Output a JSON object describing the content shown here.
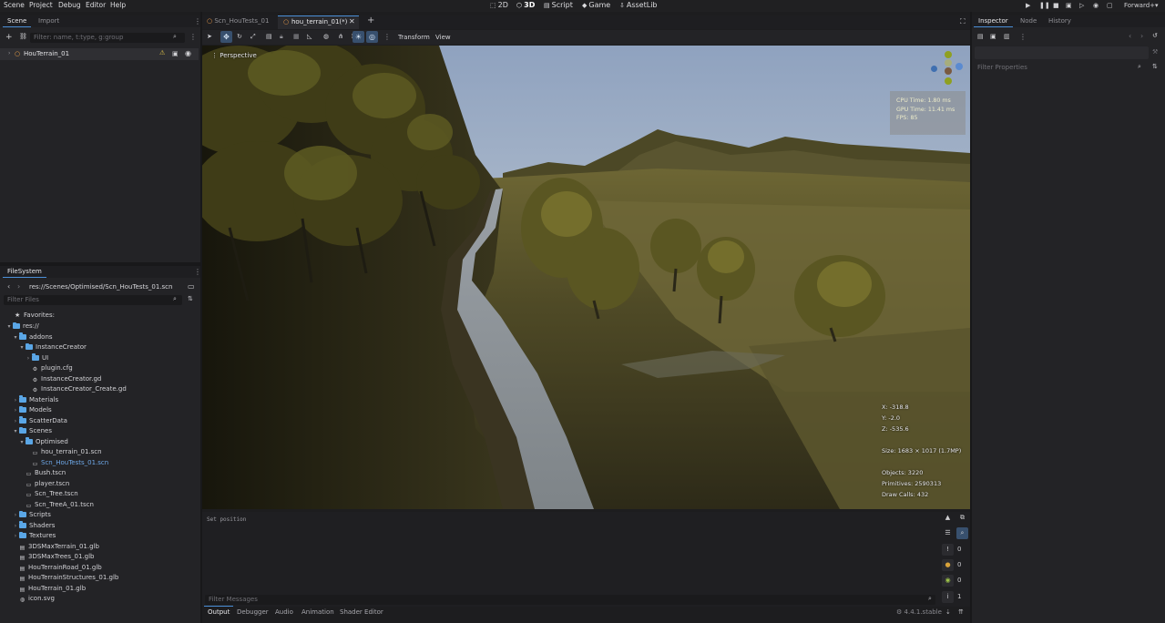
{
  "menubar": {
    "items": [
      "Scene",
      "Project",
      "Debug",
      "Editor",
      "Help"
    ],
    "workspaces": [
      {
        "label": "2D",
        "icon": "2d-icon"
      },
      {
        "label": "3D",
        "icon": "3d-icon"
      },
      {
        "label": "Script",
        "icon": "script-icon"
      },
      {
        "label": "Game",
        "icon": "game-icon"
      },
      {
        "label": "AssetLib",
        "icon": "assetlib-icon"
      }
    ],
    "renderer": "Forward+"
  },
  "scene_dock": {
    "tabs": [
      "Scene",
      "Import"
    ],
    "filter_placeholder": "Filter: name, t:type, g:group",
    "root_node": "HouTerrain_01"
  },
  "filesystem": {
    "tab": "FileSystem",
    "path": "res://Scenes/Optimised/Scn_HouTests_01.scn",
    "filter_placeholder": "Filter Files",
    "favorites": "Favorites:",
    "items": [
      {
        "label": "res://",
        "type": "folder",
        "depth": 0,
        "arrow": "▾"
      },
      {
        "label": "addons",
        "type": "folder",
        "depth": 1,
        "arrow": "▾"
      },
      {
        "label": "InstanceCreator",
        "type": "folder",
        "depth": 2,
        "arrow": "▾"
      },
      {
        "label": "UI",
        "type": "folder",
        "depth": 3,
        "arrow": "›"
      },
      {
        "label": "plugin.cfg",
        "type": "cfg",
        "depth": 3,
        "arrow": ""
      },
      {
        "label": "InstanceCreator.gd",
        "type": "gd",
        "depth": 3,
        "arrow": ""
      },
      {
        "label": "InstanceCreator_Create.gd",
        "type": "gd",
        "depth": 3,
        "arrow": ""
      },
      {
        "label": "Materials",
        "type": "folder",
        "depth": 1,
        "arrow": "›"
      },
      {
        "label": "Models",
        "type": "folder",
        "depth": 1,
        "arrow": "›"
      },
      {
        "label": "ScatterData",
        "type": "folder",
        "depth": 1,
        "arrow": "›"
      },
      {
        "label": "Scenes",
        "type": "folder",
        "depth": 1,
        "arrow": "▾"
      },
      {
        "label": "Optimised",
        "type": "folder",
        "depth": 2,
        "arrow": "▾"
      },
      {
        "label": "hou_terrain_01.scn",
        "type": "scene",
        "depth": 3,
        "arrow": ""
      },
      {
        "label": "Scn_HouTests_01.scn",
        "type": "scene-selected",
        "depth": 3,
        "arrow": ""
      },
      {
        "label": "Bush.tscn",
        "type": "scene",
        "depth": 2,
        "arrow": ""
      },
      {
        "label": "player.tscn",
        "type": "scene",
        "depth": 2,
        "arrow": ""
      },
      {
        "label": "Scn_Tree.tscn",
        "type": "scene",
        "depth": 2,
        "arrow": ""
      },
      {
        "label": "Scn_TreeA_01.tscn",
        "type": "scene",
        "depth": 2,
        "arrow": ""
      },
      {
        "label": "Scripts",
        "type": "folder",
        "depth": 1,
        "arrow": "›"
      },
      {
        "label": "Shaders",
        "type": "folder",
        "depth": 1,
        "arrow": "›"
      },
      {
        "label": "Textures",
        "type": "folder",
        "depth": 1,
        "arrow": "›"
      },
      {
        "label": "3DSMaxTerrain_01.glb",
        "type": "glb",
        "depth": 1,
        "arrow": ""
      },
      {
        "label": "3DSMaxTrees_01.glb",
        "type": "glb",
        "depth": 1,
        "arrow": ""
      },
      {
        "label": "HouTerrainRoad_01.glb",
        "type": "glb",
        "depth": 1,
        "arrow": ""
      },
      {
        "label": "HouTerrainStructures_01.glb",
        "type": "glb",
        "depth": 1,
        "arrow": ""
      },
      {
        "label": "HouTerrain_01.glb",
        "type": "glb",
        "depth": 1,
        "arrow": ""
      },
      {
        "label": "icon.svg",
        "type": "svg",
        "depth": 1,
        "arrow": ""
      }
    ]
  },
  "scene_tabs": [
    {
      "label": "Scn_HouTests_01",
      "active": false
    },
    {
      "label": "hou_terrain_01(*)",
      "active": true
    }
  ],
  "viewport_toolbar": {
    "transform": "Transform",
    "view": "View"
  },
  "viewport": {
    "perspective": "Perspective",
    "cpu_time": "CPU Time: 1.80 ms",
    "gpu_time": "GPU Time: 11.41 ms",
    "fps": "FPS: 85",
    "x": "X: -318.8",
    "y": "Y: -2.0",
    "z": "Z: -535.6",
    "size": "Size: 1683 × 1017 (1.7MP)",
    "objects": "Objects: 3220",
    "primitives": "Primitives: 2590313",
    "draw_calls": "Draw Calls: 432"
  },
  "output": {
    "log_line": "Set position",
    "filter_placeholder": "Filter Messages",
    "counts": {
      "errors": "0",
      "warnings": "0",
      "editor": "0",
      "info": "1"
    }
  },
  "bottom_tabs": [
    "Output",
    "Debugger",
    "Audio",
    "Animation",
    "Shader Editor"
  ],
  "version": "4.4.1.stable",
  "inspector": {
    "tabs": [
      "Inspector",
      "Node",
      "History"
    ],
    "filter_placeholder": "Filter Properties"
  },
  "colors": {
    "accent": "#4a8fd8",
    "selected_file": "#6ea8e8",
    "folder": "#5aa6e6"
  }
}
